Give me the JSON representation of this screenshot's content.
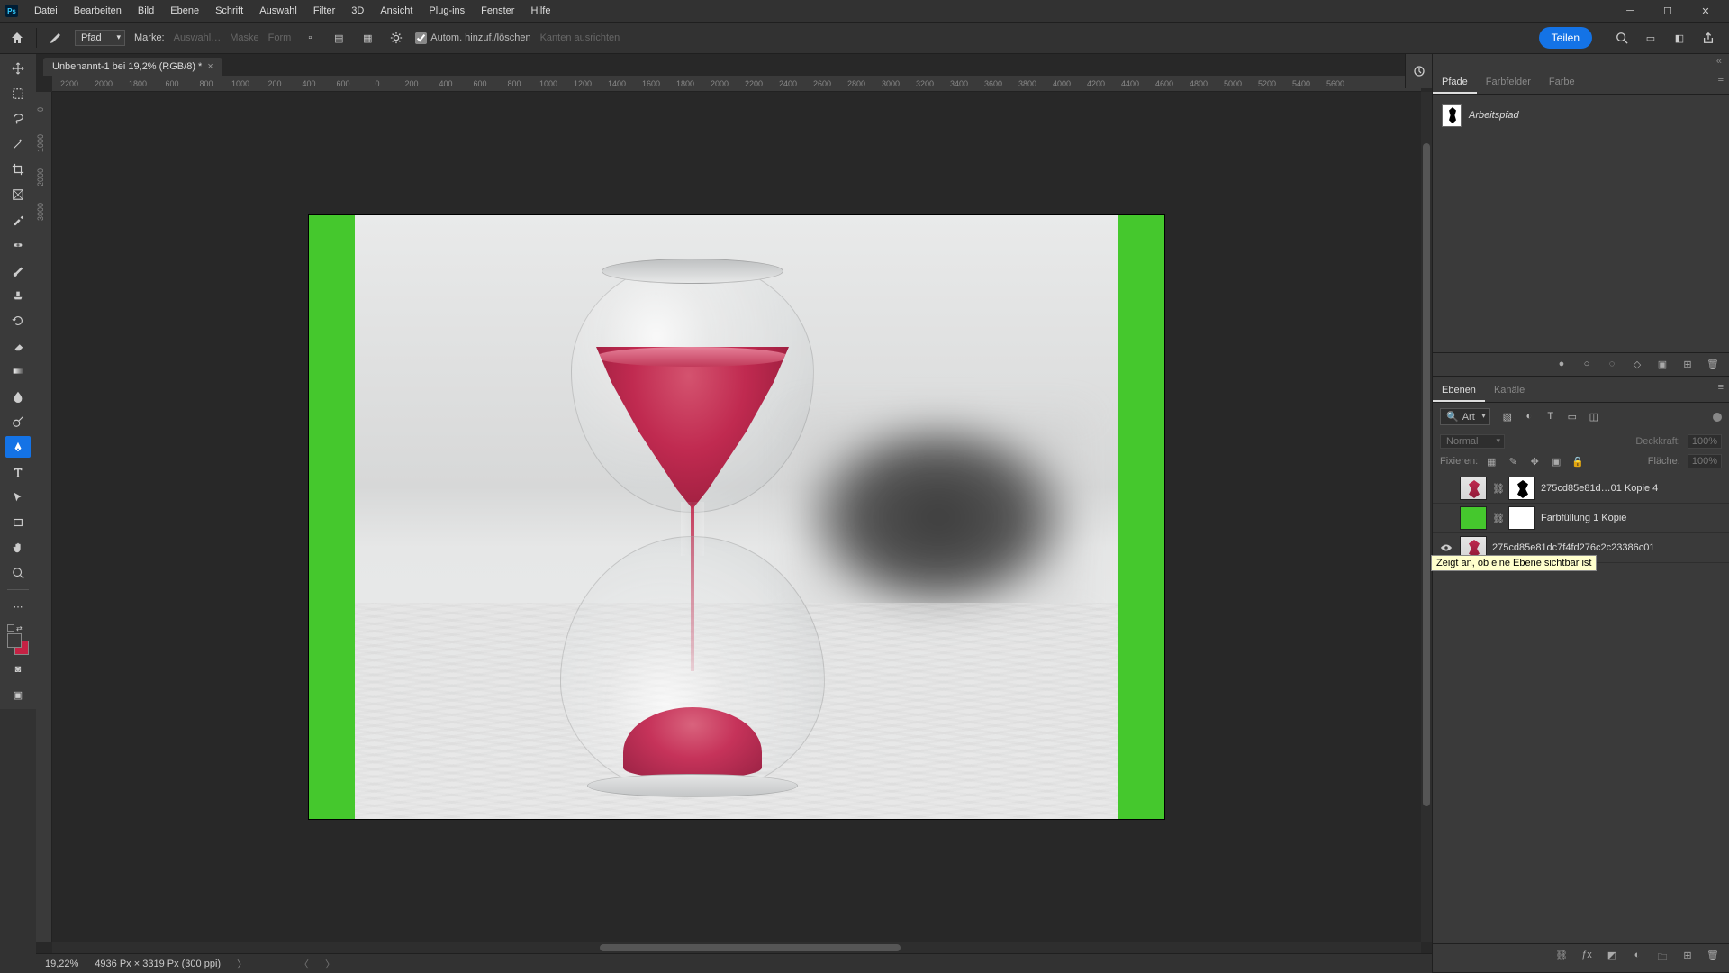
{
  "menu": {
    "file": "Datei",
    "edit": "Bearbeiten",
    "image": "Bild",
    "layer": "Ebene",
    "type": "Schrift",
    "select": "Auswahl",
    "filter": "Filter",
    "threeD": "3D",
    "view": "Ansicht",
    "plugins": "Plug-ins",
    "window": "Fenster",
    "help": "Hilfe"
  },
  "options": {
    "pathDropdown": "Pfad",
    "make": "Marke:",
    "selection": "Auswahl…",
    "mask": "Maske",
    "shape": "Form",
    "autoAddDelete": "Autom. hinzuf./löschen",
    "alignEdges": "Kanten ausrichten",
    "share": "Teilen"
  },
  "document": {
    "tab": "Unbenannt-1 bei 19,2% (RGB/8) *"
  },
  "ruler": {
    "h": [
      "2200",
      "2000",
      "1800",
      "600",
      "800",
      "1000",
      "200",
      "400",
      "600",
      "0",
      "200",
      "400",
      "600",
      "800",
      "1000",
      "1200",
      "1400",
      "1600",
      "1800",
      "2000",
      "2200",
      "2400",
      "2600",
      "2800",
      "3000",
      "3200",
      "3400",
      "3600",
      "3800",
      "4000",
      "4200",
      "4400",
      "4600",
      "4800",
      "5000",
      "5200",
      "5400",
      "5600"
    ],
    "v": [
      "0",
      "1000",
      "2000",
      "3000"
    ]
  },
  "status": {
    "zoom": "19,22%",
    "dims": "4936 Px × 3319 Px (300 ppi)"
  },
  "paths": {
    "tabs": {
      "paths": "Pfade",
      "swatches": "Farbfelder",
      "color": "Farbe"
    },
    "workPath": "Arbeitspfad"
  },
  "layers": {
    "tabs": {
      "layers": "Ebenen",
      "channels": "Kanäle"
    },
    "filterLabel": "Art",
    "blendMode": "Normal",
    "opacityLabel": "Deckkraft:",
    "opacityValue": "100%",
    "lockLabel": "Fixieren:",
    "fillLabel": "Fläche:",
    "fillValue": "100%",
    "items": [
      {
        "name": "275cd85e81d…01 Kopie 4"
      },
      {
        "name": "Farbfüllung 1 Kopie"
      },
      {
        "name": "275cd85e81dc7f4fd276c2c23386c01"
      }
    ],
    "visTooltip": "Zeigt an, ob eine Ebene sichtbar ist"
  }
}
